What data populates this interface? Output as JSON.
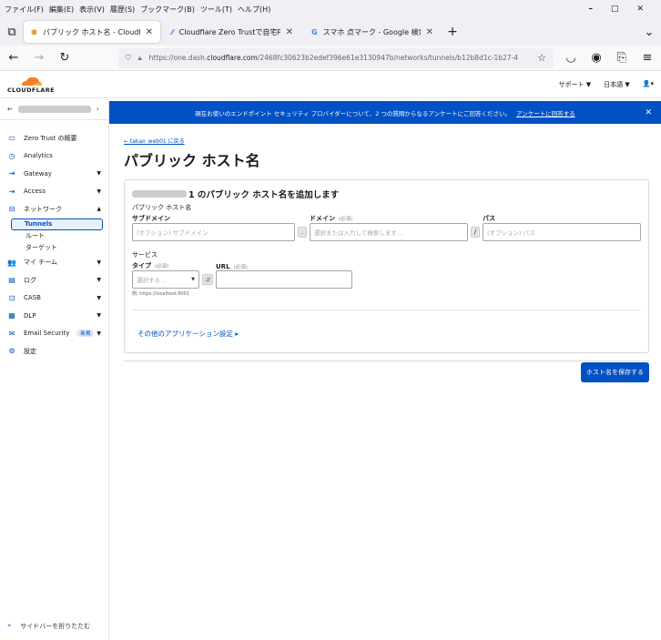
{
  "browser": {
    "menu": [
      "ファイル(F)",
      "編集(E)",
      "表示(V)",
      "履歴(S)",
      "ブックマーク(B)",
      "ツール(T)",
      "ヘルプ(H)"
    ],
    "tabs": [
      {
        "title": "パブリック ホスト名 - Cloudflare"
      },
      {
        "title": "Cloudflare Zero Trustで自宅PC..."
      },
      {
        "title": "スマホ 点マーク - Google 検索"
      }
    ],
    "url_prefix": "https://one.dash.",
    "url_domain": "cloudflare.com",
    "url_rest": "/2468fc30623b2edef396e61e3130947b/networks/tunnels/b12b8d1c-1b27-4"
  },
  "header": {
    "logo_text": "CLOUDFLARE",
    "support": "サポート ▼",
    "language": "日本語 ▼",
    "user": "👤▾"
  },
  "sidebar": {
    "items": [
      {
        "label": "Zero Trust の概要",
        "icon": "▭"
      },
      {
        "label": "Analytics",
        "icon": "◷"
      },
      {
        "label": "Gateway",
        "icon": "⇥",
        "chev": "▼"
      },
      {
        "label": "Access",
        "icon": "⇥",
        "chev": "▼"
      },
      {
        "label": "ネットワーク",
        "icon": "⊟",
        "chev": "▲"
      }
    ],
    "sub_items": [
      "Tunnels",
      "ルート",
      "ターゲット"
    ],
    "items2": [
      {
        "label": "マイ チーム",
        "icon": "👥",
        "chev": "▼"
      },
      {
        "label": "ログ",
        "icon": "▤",
        "chev": "▼"
      },
      {
        "label": "CASB",
        "icon": "⊡",
        "chev": "▼"
      },
      {
        "label": "DLP",
        "icon": "▦",
        "chev": "▼"
      },
      {
        "label": "Email Security",
        "icon": "✉",
        "chev": "▼",
        "badge": "新規"
      },
      {
        "label": "設定",
        "icon": "⚙"
      }
    ],
    "collapse_label": "サイドバーを折りたたむ"
  },
  "banner": {
    "text": "現在お使いのエンドポイント セキュリティ プロバイダーについて、2 つの質問からなるアンケートにご回答ください。",
    "link": "アンケートに回答する"
  },
  "main": {
    "back_link": "← takao_web01 に戻る",
    "title": "パブリック ホスト名",
    "card_title": "1 のパブリック ホスト名を追加します",
    "section_hostname": "パブリック ホスト名",
    "subdomain_label": "サブドメイン",
    "subdomain_placeholder": "(オプション) サブドメイン",
    "domain_label": "ドメイン",
    "domain_required": "(必須)",
    "domain_placeholder": "選択または入力して検索します...",
    "path_label": "パス",
    "path_placeholder": "(オプション) パス",
    "section_service": "サービス",
    "type_label": "タイプ",
    "type_required": "(必須)",
    "type_placeholder": "選択する...",
    "url_label": "URL",
    "url_required": "(必須)",
    "url_hint": "例: https://localhost:8001",
    "more_settings": "その他のアプリケーション設定 ▸",
    "save_button": "ホスト名を保存する"
  }
}
